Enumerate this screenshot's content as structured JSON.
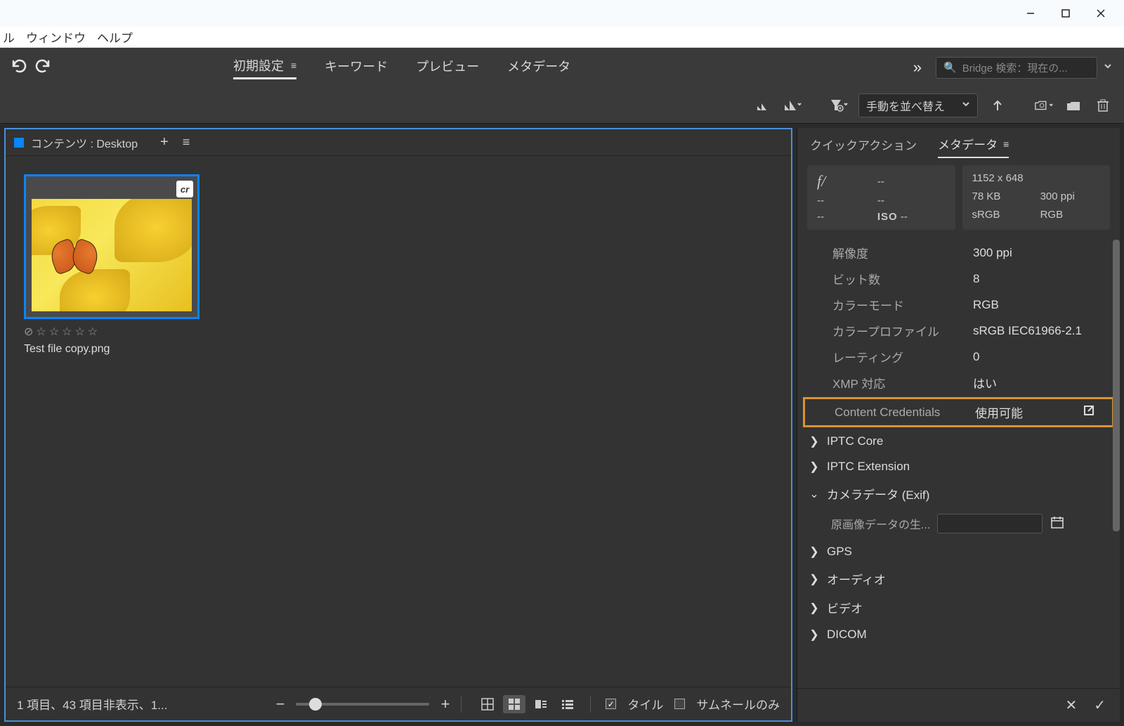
{
  "menubar": {
    "mi0": "ル",
    "mi1": "ウィンドウ",
    "mi2": "ヘルプ"
  },
  "top_tabs": {
    "t0": "初期設定",
    "t1": "キーワード",
    "t2": "プレビュー",
    "t3": "メタデータ"
  },
  "search": {
    "placeholder": "Bridge 検索：現在の..."
  },
  "tools": {
    "sort_label": "手動を並べ替え"
  },
  "content": {
    "panel_title": "コンテンツ : Desktop",
    "cr_badge": "cr",
    "filename": "Test file copy.png",
    "status": "1 項目、43 項目非表示、1...",
    "tile_label": "タイル",
    "thumb_only_label": "サムネールのみ"
  },
  "right_tabs": {
    "quick": "クイックアクション",
    "meta": "メタデータ"
  },
  "camera": {
    "aperture_label": "f/",
    "aperture": "--",
    "shutter": "--",
    "awb": "--",
    "iso_label": "ISO",
    "iso": "--",
    "ev": "--",
    "dimensions": "1152 x 648",
    "filesize": "78 KB",
    "ppi": "300 ppi",
    "colorspace": "sRGB",
    "colormode": "RGB"
  },
  "meta_rows": {
    "resolution_l": "解像度",
    "resolution_v": "300 ppi",
    "bits_l": "ビット数",
    "bits_v": "8",
    "colormode_l": "カラーモード",
    "colormode_v": "RGB",
    "profile_l": "カラープロファイル",
    "profile_v": "sRGB IEC61966-2.1",
    "rating_l": "レーティング",
    "rating_v": "0",
    "xmp_l": "XMP 対応",
    "xmp_v": "はい",
    "cc_l": "Content Credentials",
    "cc_v": "使用可能"
  },
  "groups": {
    "iptc_core": "IPTC Core",
    "iptc_ext": "IPTC Extension",
    "camera_data": "カメラデータ (Exif)",
    "exif_orig_label": "原画像データの生...",
    "gps": "GPS",
    "audio": "オーディオ",
    "video": "ビデオ",
    "dicom": "DICOM"
  }
}
